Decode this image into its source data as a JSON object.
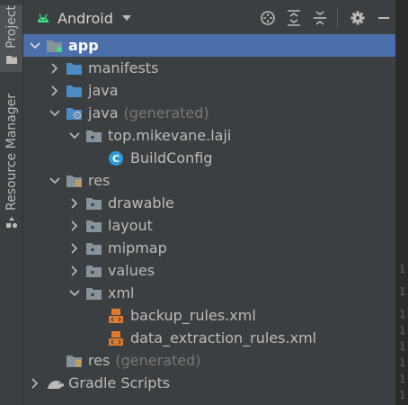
{
  "side_tabs": {
    "project": "Project",
    "resource_manager": "Resource Manager"
  },
  "toolbar": {
    "title": "Android"
  },
  "tree": [
    {
      "label": "app",
      "generated": ""
    },
    {
      "label": "manifests",
      "generated": ""
    },
    {
      "label": "java",
      "generated": ""
    },
    {
      "label": "java",
      "generated": "(generated)"
    },
    {
      "label": "top.mikevane.laji",
      "generated": ""
    },
    {
      "label": "BuildConfig",
      "generated": ""
    },
    {
      "label": "res",
      "generated": ""
    },
    {
      "label": "drawable",
      "generated": ""
    },
    {
      "label": "layout",
      "generated": ""
    },
    {
      "label": "mipmap",
      "generated": ""
    },
    {
      "label": "values",
      "generated": ""
    },
    {
      "label": "xml",
      "generated": ""
    },
    {
      "label": "backup_rules.xml",
      "generated": ""
    },
    {
      "label": "data_extraction_rules.xml",
      "generated": ""
    },
    {
      "label": "res",
      "generated": "(generated)"
    },
    {
      "label": "Gradle Scripts",
      "generated": ""
    }
  ],
  "gutter_digits": [
    "1",
    "1",
    "1",
    "1",
    "1",
    "1",
    "1",
    "1",
    "1"
  ],
  "colors": {
    "background": "#3c3f41",
    "selection": "#4a6fab",
    "folder": "#87939a",
    "source_folder": "#4b8cc5",
    "xml": "#e07a2f",
    "class": "#2f9bd7"
  }
}
